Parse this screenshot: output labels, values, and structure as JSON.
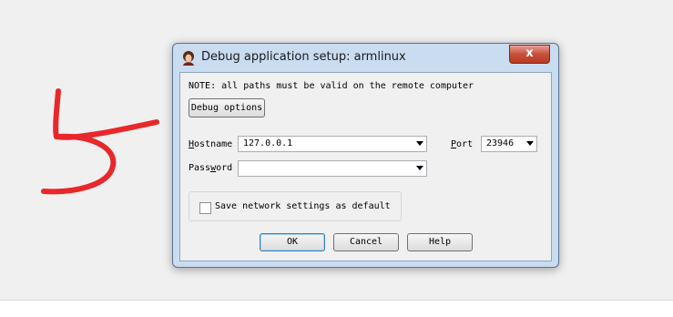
{
  "dialog": {
    "title": "Debug application setup: armlinux",
    "close_label": "x",
    "note": "NOTE: all paths must be valid on the remote computer",
    "debug_options_label": "Debug options",
    "hostname": {
      "label_prefix": "H",
      "label_rest": "ostname",
      "value": "127.0.0.1"
    },
    "port": {
      "label_prefix": "P",
      "label_rest": "ort",
      "value": "23946"
    },
    "password": {
      "label_start": "Pass",
      "label_accel": "w",
      "label_end": "ord",
      "value": ""
    },
    "save_label": "Save network settings as default",
    "save_checked": false,
    "ok_label": "OK",
    "cancel_label": "Cancel",
    "help_label": "Help"
  },
  "annotation": {
    "color": "#e8282a"
  }
}
